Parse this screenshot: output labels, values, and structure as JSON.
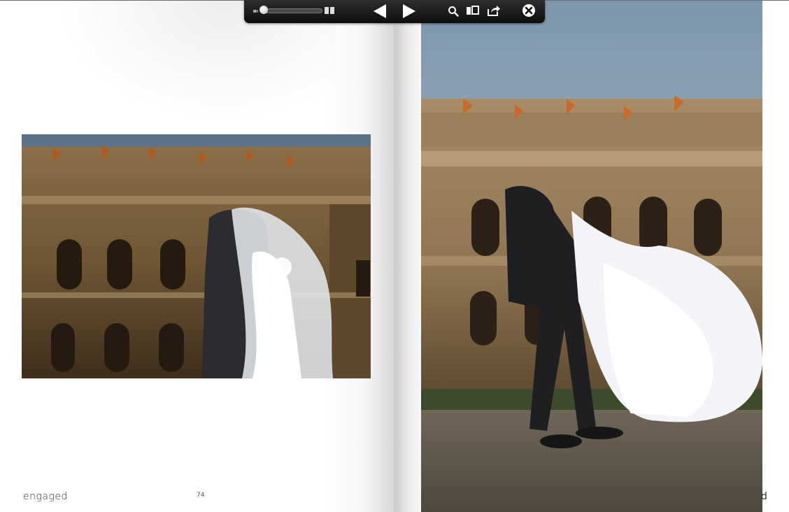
{
  "viewer": {
    "toolbar": {
      "zoom_level": 0.0,
      "icons": {
        "zoom_out": "dot-icon",
        "zoom_in": "double-square-icon",
        "previous": "triangle-left-icon",
        "next": "triangle-right-icon",
        "search": "magnifier-icon",
        "thumbnails": "thumbnails-icon",
        "share": "share-arrow-icon",
        "close": "close-circle-icon"
      }
    }
  },
  "spread": {
    "left_page": {
      "brand": "engaged",
      "page_number": "74",
      "photo": "wedding-couple-kiss-veil-building"
    },
    "right_page": {
      "brand_fragment": "d",
      "photo": "wedding-couple-lift-dress-building"
    }
  },
  "colors": {
    "toolbar_bg": "#1c1c1c",
    "page_bg": "#ffffff",
    "text": "#333333"
  }
}
